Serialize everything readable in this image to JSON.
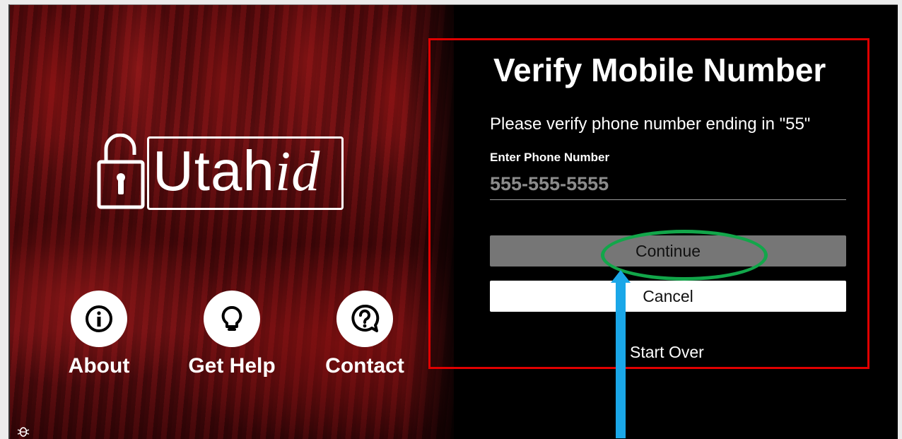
{
  "branding": {
    "logo_main": "Utah",
    "logo_suffix": "id"
  },
  "nav": {
    "about_label": "About",
    "help_label": "Get Help",
    "contact_label": "Contact"
  },
  "form": {
    "title": "Verify Mobile Number",
    "subtitle": "Please verify phone number ending in \"55\"",
    "field_label": "Enter Phone Number",
    "phone_placeholder": "555-555-5555",
    "phone_value": "",
    "continue_label": "Continue",
    "cancel_label": "Cancel",
    "start_over_label": "Start Over"
  },
  "annotations": {
    "highlight_box_color": "#e00000",
    "highlight_ellipse_color": "#12a64a",
    "arrow_color": "#1aa7e8"
  },
  "icons": {
    "lock": "open-padlock-icon",
    "about": "info-icon",
    "help": "lightbulb-icon",
    "contact": "question-bubble-icon",
    "debug": "bug-icon"
  }
}
